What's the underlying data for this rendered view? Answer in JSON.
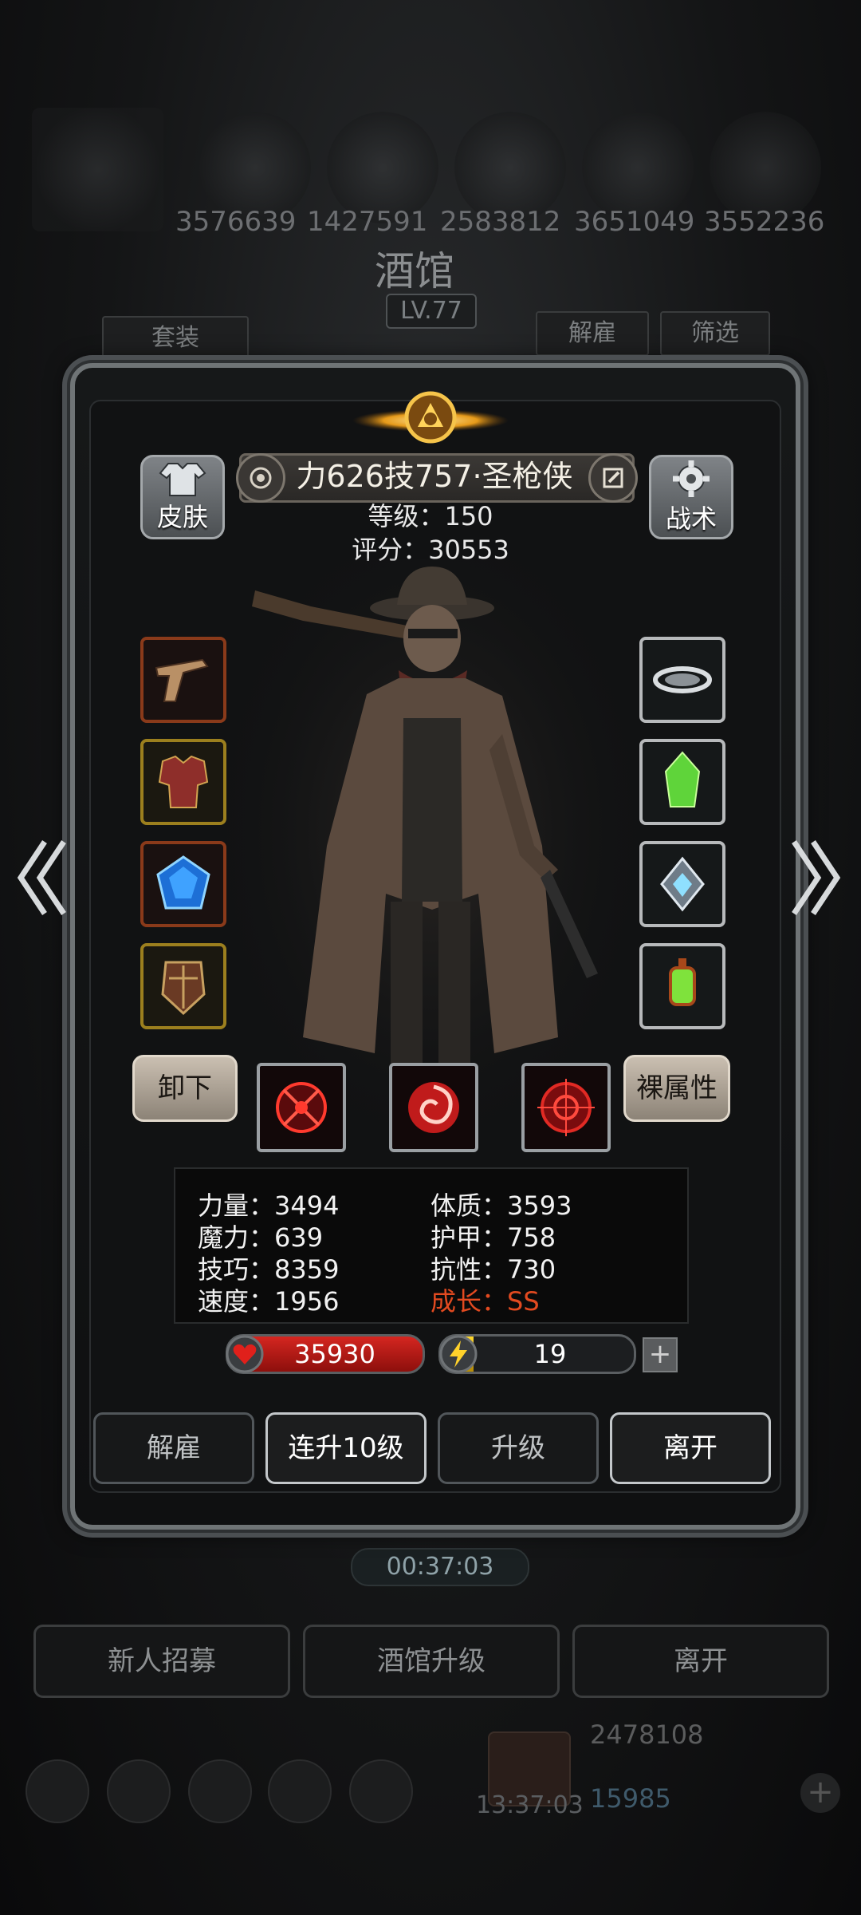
{
  "background": {
    "stat_values": [
      "3576639",
      "1427591",
      "2583812",
      "3651049",
      "3552236"
    ],
    "title": "酒馆",
    "level": "LV.77",
    "left_tab": "套装",
    "dismiss_tab": "解雇",
    "filter_tab": "筛选",
    "timer": "00:37:03",
    "bottom_buttons": [
      "新人招募",
      "酒馆升级",
      "离开"
    ],
    "gold": "2478108",
    "gems": "15985",
    "clock": "13:37:03"
  },
  "hero": {
    "name": "力626技757·圣枪侠",
    "level_label": "等级：150",
    "score_label": "评分：30553",
    "skin_label": "皮肤",
    "tactics_label": "战术",
    "unequip_label": "卸下",
    "base_attr_label": "裸属性",
    "equipment_left": [
      "flintlock-pistol-icon",
      "crimson-armor-icon",
      "blue-gem-icon",
      "rune-shield-icon"
    ],
    "equipment_right": [
      "storm-cloud-ring-icon",
      "green-crystal-icon",
      "silver-amulet-icon",
      "green-lantern-icon"
    ]
  },
  "stats": {
    "strength": "力量：3494",
    "magic": "魔力：639",
    "skill": "技巧：8359",
    "speed": "速度：1956",
    "constitution": "体质：3593",
    "armor": "护甲：758",
    "resistance": "抗性：730",
    "growth": "成长：SS"
  },
  "bars": {
    "hp": "35930",
    "energy": "19",
    "energy_fraction": 0.17
  },
  "dialog_buttons": {
    "dismiss": "解雇",
    "level_up_10": "连升10级",
    "level_up": "升级",
    "leave": "离开"
  },
  "colors": {
    "growth": "#e24a20",
    "hp": "#d52620",
    "energy": "#ffd72b"
  }
}
